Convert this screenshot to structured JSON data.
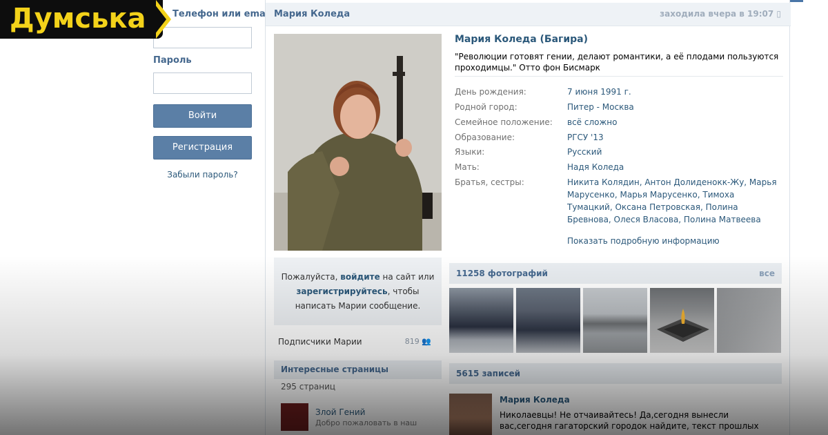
{
  "brand": {
    "logo_text": "Думська"
  },
  "login": {
    "email_label": "Телефон или email",
    "email_value": "",
    "password_label": "Пароль",
    "password_value": "",
    "login_button": "Войти",
    "register_button": "Регистрация",
    "forgot_link": "Забыли пароль?"
  },
  "header": {
    "page_name": "Мария Коледа",
    "last_seen": "заходила вчера в 19:07"
  },
  "profile": {
    "full_name": "Мария Коледа (Багира)",
    "status": "\"Революции готовят гении, делают романтики, а её плодами пользуются проходимцы.\" Отто фон Бисмарк",
    "fields": [
      {
        "key": "День рождения:",
        "value": "7 июня 1991 г."
      },
      {
        "key": "Родной город:",
        "value": "Питер - Москва"
      },
      {
        "key": "Семейное положение:",
        "value": "всё сложно"
      },
      {
        "key": "Образование:",
        "value": "РГСУ '13"
      },
      {
        "key": "Языки:",
        "value": "Русский"
      },
      {
        "key": "Мать:",
        "value": "Надя Коледа"
      },
      {
        "key": "Братья, сестры:",
        "value": "Никита Колядин, Антон Долиденокк-Жу, Марья Марусенко, Марья Марусенко, Тимоха Тумацкий, Оксана Петровская, Полина Бревнова, Олеся Власова, Полина Матвеева"
      }
    ],
    "more_info_link": "Показать подробную информацию"
  },
  "message_box": {
    "text_1": "Пожалуйста, ",
    "login_word": "войдите",
    "text_2": " на сайт или",
    "register_word": "зарегистрируйтесь",
    "text_3": ", чтобы",
    "text_4": "написать Марии сообщение."
  },
  "subscribers": {
    "label": "Подписчики Марии",
    "count": "819"
  },
  "interesting": {
    "title": "Интересные страницы",
    "count": "295 страниц",
    "item_name": "Злой Гений",
    "item_sub": "Добро пожаловать в наш"
  },
  "photos": {
    "title": "11258 фотографий",
    "all_link": "все"
  },
  "posts": {
    "title": "5615 записей",
    "author": "Мария Коледа",
    "line_1": "Николаевцы! Не отчаивайтесь! Да,сегодня вынесли",
    "line_2": "вас,сегодня гагаторский городок найдите, текст прошлых"
  },
  "colors": {
    "link": "#2b587a",
    "header_text": "#45688e",
    "button": "#5b7fa6",
    "brand_yellow": "#f3d21a"
  }
}
